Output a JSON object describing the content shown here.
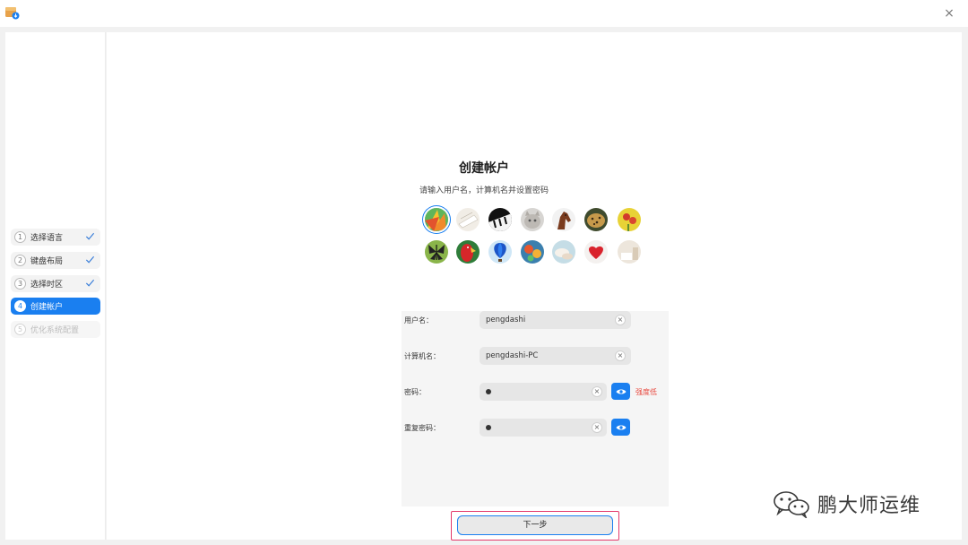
{
  "window": {
    "app_icon": "installer-package-icon",
    "close_label": "×"
  },
  "sidebar": {
    "steps": [
      {
        "number": "1",
        "label": "选择语言",
        "state": "done"
      },
      {
        "number": "2",
        "label": "键盘布局",
        "state": "done"
      },
      {
        "number": "3",
        "label": "选择时区",
        "state": "done"
      },
      {
        "number": "4",
        "label": "创建帐户",
        "state": "active"
      },
      {
        "number": "5",
        "label": "优化系统配置",
        "state": "disabled"
      }
    ]
  },
  "main": {
    "title": "创建帐户",
    "subtitle": "请输入用户名，计算机名并设置密码",
    "avatars": [
      "flower-petals",
      "paper",
      "piano-keys",
      "cat",
      "horse",
      "leopard",
      "yellow-flower",
      "butterfly",
      "parrot",
      "hot-air-balloon",
      "hot-air-balloons",
      "seashells",
      "red-heart",
      "room"
    ],
    "form": {
      "username": {
        "label": "用户名：",
        "value": "pengdashi"
      },
      "computer_name": {
        "label": "计算机名：",
        "value": "pengdashi-PC"
      },
      "password": {
        "label": "密码：",
        "strength": "强度低"
      },
      "repeat_password": {
        "label": "重复密码："
      },
      "clear_label": "×"
    },
    "next_button": "下一步"
  },
  "watermark": {
    "text": "鹏大师运维",
    "icon": "wechat-icon"
  },
  "colors": {
    "accent": "#1a7ff0",
    "warning": "#e8463c",
    "highlight_border": "#e4386a"
  }
}
